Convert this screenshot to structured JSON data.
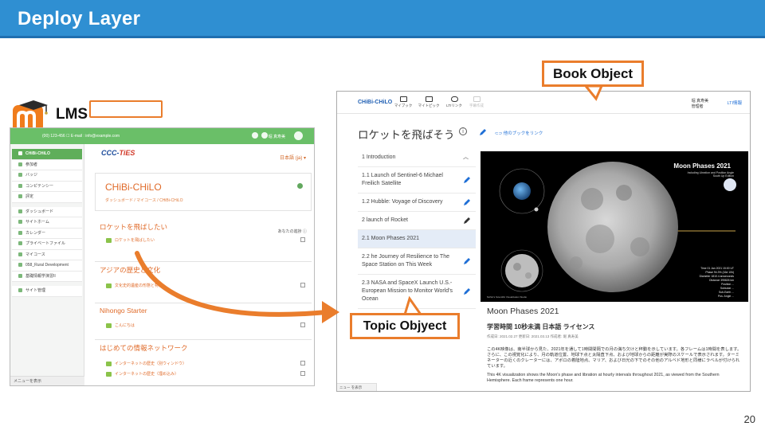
{
  "slide": {
    "title": "Deploy Layer",
    "page_number": "20",
    "lms_label": "LMS",
    "callouts": {
      "book": "Book Object",
      "topic": "Topic Objyect"
    },
    "colors": {
      "title_bar": "#2f8fd2",
      "accent_orange": "#ea7d2c",
      "lms_green": "#6abf68"
    }
  },
  "lms": {
    "contact": "(00) 123-456 ☐ E-mail : info@example.com",
    "user": "堀 真寿美",
    "sidebar": [
      {
        "label": "CHiBi-CHiLO",
        "active": true
      },
      {
        "label": "参加者"
      },
      {
        "label": "バッジ"
      },
      {
        "label": "コンピテンシー"
      },
      {
        "label": "評定"
      },
      {
        "label": "ダッシュボード"
      },
      {
        "label": "サイトホーム"
      },
      {
        "label": "カレンダー"
      },
      {
        "label": "プライベートファイル"
      },
      {
        "label": "マイコース"
      },
      {
        "label": "058_Rural Development"
      },
      {
        "label": "基礎情報学演習II"
      },
      {
        "label": "サイト管理"
      }
    ],
    "bottom": "メニューを表示",
    "brand": {
      "main": "CCC-",
      "accent": "TiES"
    },
    "language": "日本語 (ja) ▾",
    "course_title": "CHiBi-CHiLO",
    "breadcrumb": "ダッシュボード / マイコース / CHiBi-CHiLO",
    "progress_label": "あなたの進捗 ⓘ",
    "sections": [
      {
        "title": "ロケットを飛ばしたい",
        "activities": [
          "ロケットを飛ばしたい"
        ]
      },
      {
        "title": "アジアの歴史と文化",
        "activities": [
          "文化史的遺産の形態と特徴"
        ]
      },
      {
        "title": "Nihongo Starter",
        "activities": [
          "こんにちは"
        ]
      },
      {
        "title": "はじめての情報ネットワーク",
        "activities": [
          "インターネットの歴史（別ウィンドウ）",
          "インターネットの歴史（埋め込み）"
        ]
      }
    ]
  },
  "chilo": {
    "logo": "CHiBi-CHiLO",
    "nav": [
      {
        "label": "マイブック"
      },
      {
        "label": "マイトピック"
      },
      {
        "label": "LTIリンク"
      },
      {
        "label": "字幕作成"
      }
    ],
    "user_name": "堀 真寿美",
    "user_role": "管理者",
    "lti_info": "LTI情報",
    "book_title": "ロケットを飛ばそう",
    "info_icon": "i",
    "other_book_link": "他のブックをリンク",
    "toc": [
      {
        "label": "1 Introduction",
        "kind": "section"
      },
      {
        "label": "1.1 Launch of Sentinel-6 Michael Freilich Satellite",
        "kind": "topic"
      },
      {
        "label": "1.2 Hubble: Voyage of Discovery",
        "kind": "topic"
      },
      {
        "label": "2 launch of Rocket",
        "kind": "section"
      },
      {
        "label": "2.1 Moon Phases 2021",
        "kind": "topic",
        "active": true
      },
      {
        "label": "2.2 he Journey of Resilience to The Space Station on This Week",
        "kind": "topic"
      },
      {
        "label": "2.3 NASA and SpaceX Launch U.S.-European Mission to Monitor World's Ocean",
        "kind": "topic"
      }
    ],
    "video": {
      "title": "Moon Phases 2021",
      "subtitle": "Including Libration and Position Angle\nSouth Up Edition",
      "meta": "Time  01 Jan 2021 15:00 UT\nPhase  94.3% (16d 10h)\nDiameter  1810.4 arcseconds\nDistance  395826 km\nPosition  ...\nSubsolar  ...\nSub-Earth  ...\nPos. Angle  ...",
      "credit": "NASA's Scientific Visualization Studio"
    },
    "topic_title": "Moon Phases 2021",
    "topic_meta": "学習時間 10秒未満  日本語  ライセンス",
    "dates": "作成日: 2021.02.27    更新日: 2021.03.13    作成者: 堀 真寿美",
    "description_ja": "この4K映像は、南半球から見た、2021年を通して1時間間隔での月の満ち欠けと秤動を示しています。各フレームは1時間を表します。さらに、この視覚化により、月の軌道位置、地球下点と太陽直下点、および地球からの距離が実際のスケールで表示されます。ターミネーターの近くのクレーターには、アポロの着陸地点、マリア、および日光の下でのその他のアルベド地形と同様にラベルが付けられています。",
    "description_en": "This 4K visualization shows the Moon's phase and libration at hourly intervals throughout 2021, as viewed from the Southern Hemisphere. Each frame represents one hour.",
    "bottom": "ニュー を表示"
  }
}
